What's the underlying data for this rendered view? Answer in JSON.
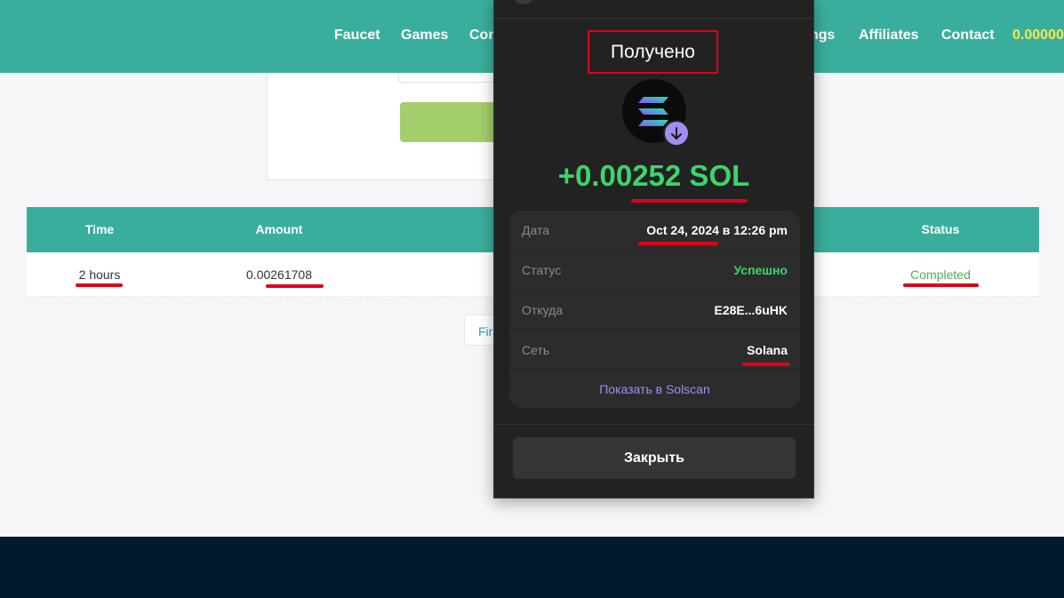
{
  "nav": {
    "items": [
      "Faucet",
      "Games",
      "Con",
      "ngs",
      "Affiliates",
      "Contact"
    ],
    "balance": "0.00000"
  },
  "table": {
    "headers": {
      "time": "Time",
      "amount": "Amount",
      "status": "Status"
    },
    "row": {
      "time": "2 hours",
      "amount": "0.00261708",
      "status": "Completed"
    }
  },
  "pager": {
    "first_label": "Fir"
  },
  "wallet": {
    "title": "Получено",
    "amount": "+0.00252 SOL",
    "details": {
      "date_label": "Дата",
      "date_value": "Oct 24, 2024 в 12:26 pm",
      "status_label": "Статус",
      "status_value": "Успешно",
      "from_label": "Откуда",
      "from_value": "E28E...6uHK",
      "network_label": "Сеть",
      "network_value": "Solana",
      "explorer_link": "Показать в Solscan"
    },
    "close_label": "Закрыть"
  },
  "colors": {
    "accent": "#3aae9c",
    "success": "#3dd46c",
    "link": "#a58cf0",
    "highlight": "#e0001b",
    "footer": "#001a2f"
  },
  "icons": [
    "solana-logo-icon",
    "arrow-down-icon"
  ]
}
